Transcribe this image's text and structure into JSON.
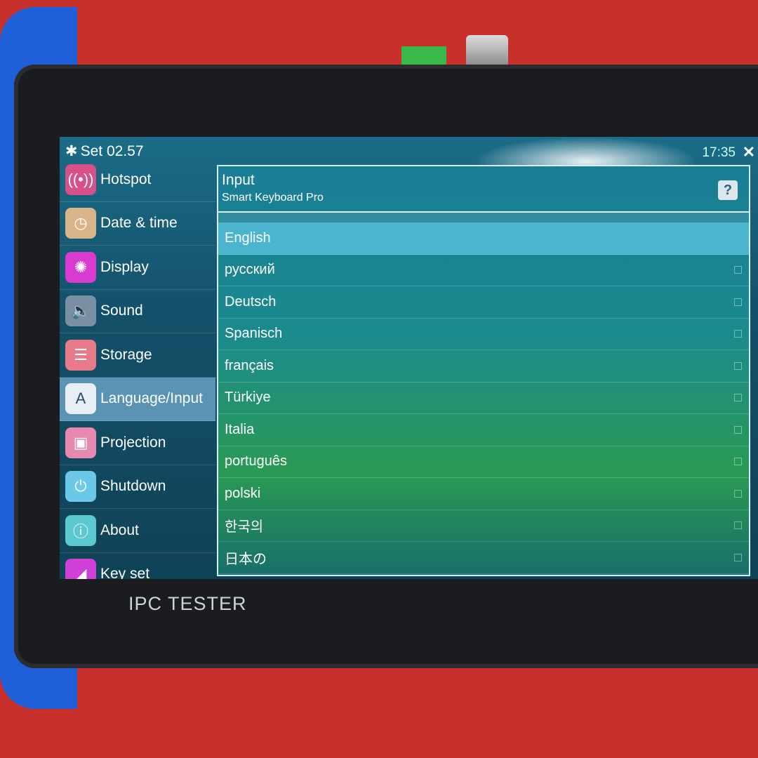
{
  "header": {
    "title": "Set 02.57",
    "time": "17:35",
    "brand": "IPC TESTER"
  },
  "sidebar": {
    "items": [
      {
        "label": "Hotspot",
        "icon": "hotspot-icon",
        "color": "#d8508a",
        "glyph": "((•))"
      },
      {
        "label": "Date & time",
        "icon": "clock-icon",
        "color": "#d9b48a",
        "glyph": "◷"
      },
      {
        "label": "Display",
        "icon": "brightness-icon",
        "color": "#d93ad0",
        "glyph": "✺"
      },
      {
        "label": "Sound",
        "icon": "speaker-icon",
        "color": "#7a8fa3",
        "glyph": "🔈"
      },
      {
        "label": "Storage",
        "icon": "storage-icon",
        "color": "#e87a8a",
        "glyph": "☰"
      },
      {
        "label": "Language/Input",
        "icon": "language-icon",
        "color": "#e8eef5",
        "glyph": "A"
      },
      {
        "label": "Projection",
        "icon": "projection-icon",
        "color": "#e888b0",
        "glyph": "▣"
      },
      {
        "label": "Shutdown",
        "icon": "power-icon",
        "color": "#6cc8e8",
        "glyph": "⏻"
      },
      {
        "label": "About",
        "icon": "info-icon",
        "color": "#5cc8d0",
        "glyph": "ⓘ"
      },
      {
        "label": "Key set",
        "icon": "key-set-icon",
        "color": "#d040d8",
        "glyph": "◢"
      }
    ],
    "active": 5
  },
  "panel": {
    "title": "Input",
    "subtitle": "Smart Keyboard Pro",
    "help": "?",
    "languages": [
      "English",
      "русский",
      "Deutsch",
      "Spanisch",
      "français",
      "Türkiye",
      "Italia",
      "português",
      "polski",
      "한국의",
      "日本の"
    ],
    "selected": 0
  }
}
